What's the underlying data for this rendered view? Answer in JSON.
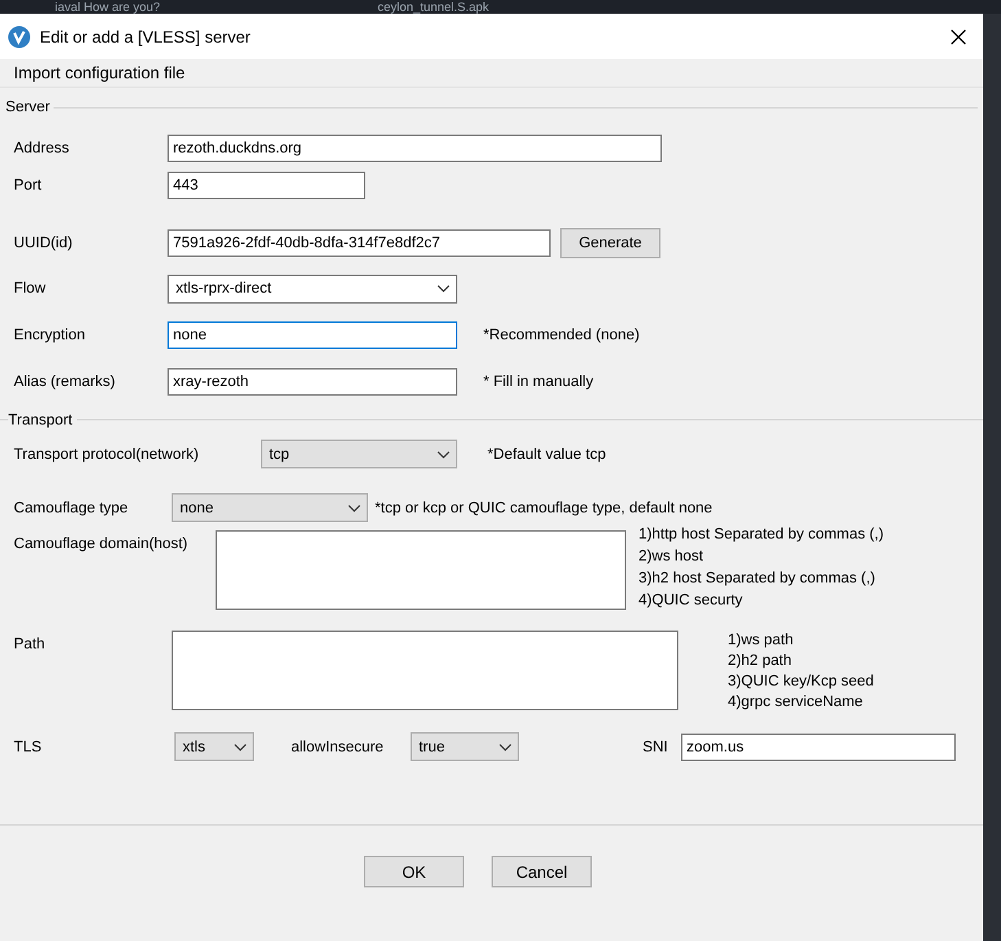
{
  "background": {
    "texts": [
      "iaval How are you?",
      "ceylon_tunnel.S.apk"
    ]
  },
  "window": {
    "title": "Edit or add a [VLESS] server"
  },
  "menu": [
    "Import configuration file"
  ],
  "server": {
    "title": "Server",
    "fields": [
      {
        "label": "Address",
        "kind": "text",
        "value": "rezoth.duckdns.org",
        "focused": false
      },
      {
        "label": "Port",
        "kind": "text",
        "value": "443",
        "focused": false
      },
      {
        "label": "UUID(id)",
        "kind": "text",
        "value": "7591a926-2fdf-40db-8dfa-314f7e8df2c7",
        "focused": false,
        "button": "Generate"
      },
      {
        "label": "Flow",
        "kind": "select",
        "value": "xtls-rprx-direct"
      },
      {
        "label": "Encryption",
        "kind": "text",
        "value": "none",
        "focused": true,
        "note": "*Recommended (none)"
      },
      {
        "label": "Alias (remarks)",
        "kind": "text",
        "value": "xray-rezoth",
        "focused": false,
        "note": "* Fill in manually"
      }
    ]
  },
  "transport": {
    "title": "Transport",
    "rows": [
      {
        "label": "Transport protocol(network)",
        "kind": "select",
        "value": "tcp",
        "note": "*Default value tcp"
      },
      {
        "label": "Camouflage type",
        "kind": "select",
        "value": "none",
        "note": "*tcp or kcp or QUIC camouflage type, default none"
      },
      {
        "label": "Camouflage domain(host)",
        "kind": "textarea",
        "notes": [
          "1)http host Separated by commas (,)",
          "2)ws host",
          "3)h2 host Separated by commas (,)",
          "4)QUIC securty"
        ]
      },
      {
        "label": "Path",
        "kind": "textarea",
        "notes": [
          "1)ws path",
          "2)h2 path",
          "3)QUIC key/Kcp seed",
          "4)grpc serviceName"
        ]
      },
      {
        "kind": "inline",
        "items": [
          {
            "label": "TLS",
            "kind": "select",
            "value": "xtls"
          },
          {
            "label": "allowInsecure",
            "kind": "select",
            "value": "true"
          },
          {
            "label": "SNI",
            "kind": "text",
            "value": "zoom.us"
          }
        ]
      }
    ]
  },
  "buttons": [
    "OK",
    "Cancel"
  ]
}
